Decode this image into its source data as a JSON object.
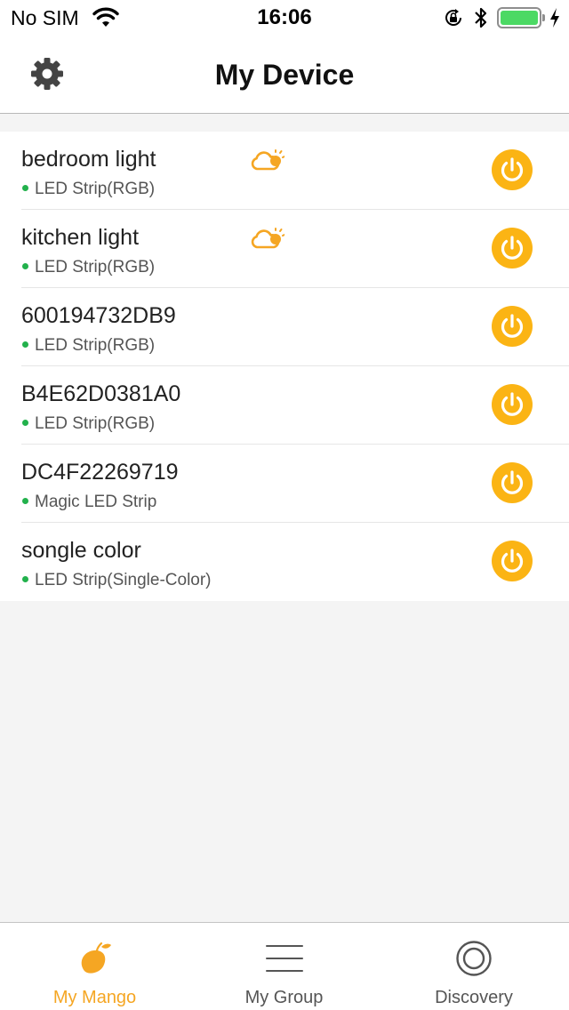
{
  "status_bar": {
    "carrier": "No SIM",
    "time": "16:06"
  },
  "nav": {
    "title": "My Device"
  },
  "devices": [
    {
      "name": "bedroom light",
      "type": "LED Strip(RGB)",
      "cloud": true
    },
    {
      "name": "kitchen light",
      "type": "LED Strip(RGB)",
      "cloud": true
    },
    {
      "name": "600194732DB9",
      "type": "LED Strip(RGB)",
      "cloud": false
    },
    {
      "name": "B4E62D0381A0",
      "type": "LED Strip(RGB)",
      "cloud": false
    },
    {
      "name": "DC4F22269719",
      "type": "Magic LED Strip",
      "cloud": false
    },
    {
      "name": "songle color",
      "type": "LED Strip(Single-Color)",
      "cloud": false
    }
  ],
  "tabs": [
    {
      "label": "My Mango",
      "icon": "mango-icon",
      "active": true
    },
    {
      "label": "My Group",
      "icon": "menu-lines-icon",
      "active": false
    },
    {
      "label": "Discovery",
      "icon": "discovery-icon",
      "active": false
    }
  ],
  "colors": {
    "accent": "#f5a623",
    "power_button": "#fbb414",
    "online_dot": "#22b14c",
    "battery": "#4cd964"
  }
}
